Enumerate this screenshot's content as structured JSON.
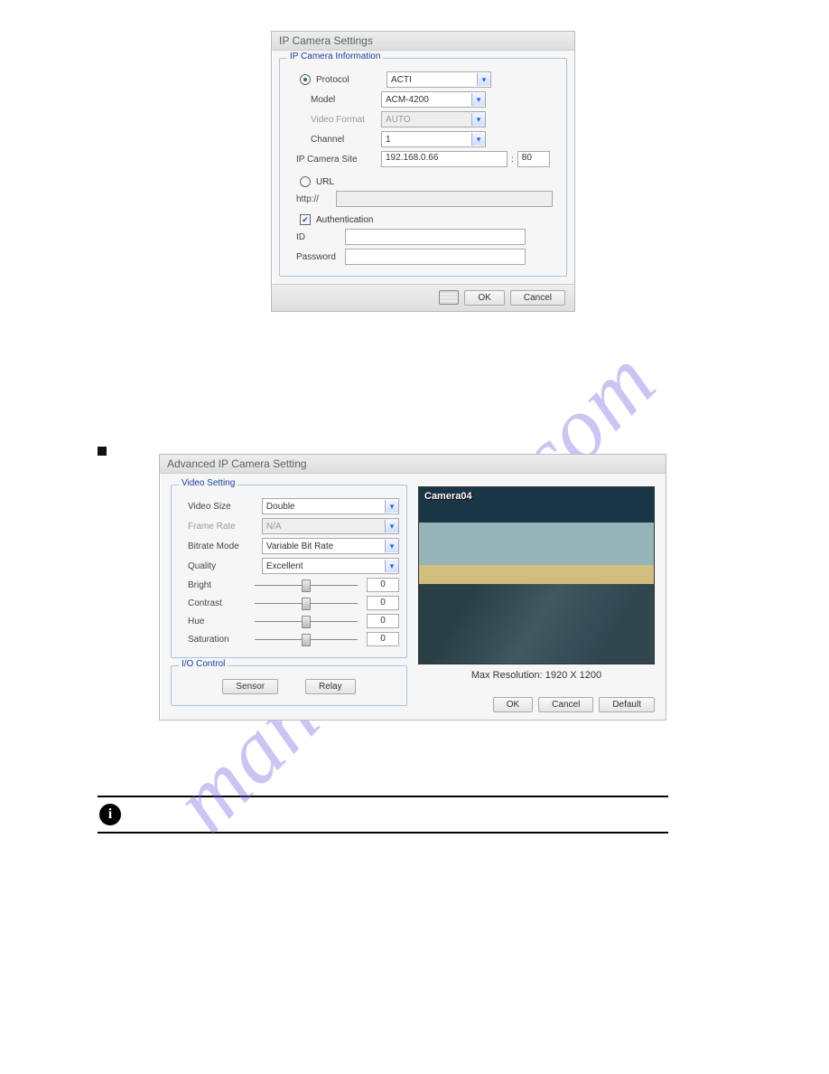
{
  "dialog1": {
    "title": "IP Camera Settings",
    "group_label": "IP Camera Information",
    "protocol_label": "Protocol",
    "protocol_value": "ACTI",
    "model_label": "Model",
    "model_value": "ACM-4200",
    "videofmt_label": "Video Format",
    "videofmt_value": "AUTO",
    "channel_label": "Channel",
    "channel_value": "1",
    "site_label": "IP Camera Site",
    "site_ip": "192.168.0.66",
    "site_port_sep": ":",
    "site_port": "80",
    "url_label": "URL",
    "url_prefix": "http://",
    "auth_label": "Authentication",
    "id_label": "ID",
    "pwd_label": "Password",
    "ok": "OK",
    "cancel": "Cancel"
  },
  "dialog2": {
    "title": "Advanced IP Camera Setting",
    "video_group": "Video Setting",
    "vsize_label": "Video Size",
    "vsize_value": "Double",
    "frate_label": "Frame Rate",
    "frate_value": "N/A",
    "bitrate_label": "Bitrate Mode",
    "bitrate_value": "Variable Bit Rate",
    "quality_label": "Quality",
    "quality_value": "Excellent",
    "bright_label": "Bright",
    "bright_value": "0",
    "contrast_label": "Contrast",
    "contrast_value": "0",
    "hue_label": "Hue",
    "hue_value": "0",
    "sat_label": "Saturation",
    "sat_value": "0",
    "io_group": "I/O Control",
    "sensor_btn": "Sensor",
    "relay_btn": "Relay",
    "camera_name": "Camera04",
    "resolution_label": "Max Resolution: 1920 X 1200",
    "ok": "OK",
    "cancel": "Cancel",
    "default": "Default"
  },
  "watermark": "manualslive.com"
}
